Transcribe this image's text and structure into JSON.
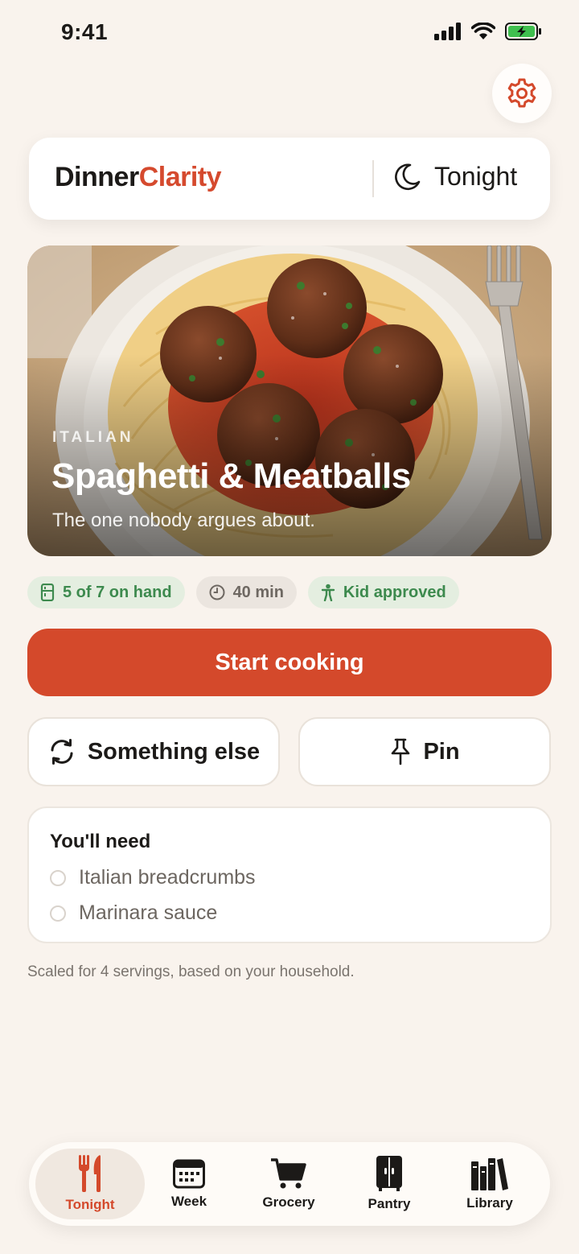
{
  "status_bar": {
    "time": "9:41"
  },
  "header": {
    "brand_part1": "Dinner",
    "brand_part2": "Clarity",
    "mode_label": "Tonight"
  },
  "hero": {
    "cuisine": "ITALIAN",
    "title": "Spaghetti & Meatballs",
    "subtitle": "The one nobody argues about."
  },
  "chips": {
    "on_hand": "5 of 7 on hand",
    "time": "40 min",
    "kid": "Kid approved"
  },
  "actions": {
    "start": "Start cooking",
    "something_else": "Something else",
    "pin": "Pin"
  },
  "need": {
    "title": "You'll need",
    "items": [
      "Italian breadcrumbs",
      "Marinara sauce"
    ]
  },
  "note": "Scaled for 4 servings, based on your household.",
  "tabs": [
    {
      "label": "Tonight",
      "icon": "fork-knife-icon",
      "active": true
    },
    {
      "label": "Week",
      "icon": "calendar-icon",
      "active": false
    },
    {
      "label": "Grocery",
      "icon": "cart-icon",
      "active": false
    },
    {
      "label": "Pantry",
      "icon": "pantry-icon",
      "active": false
    },
    {
      "label": "Library",
      "icon": "books-icon",
      "active": false
    }
  ],
  "colors": {
    "accent": "#d4492b",
    "background": "#f9f3ed",
    "chip_green": "#3d8a4e"
  }
}
